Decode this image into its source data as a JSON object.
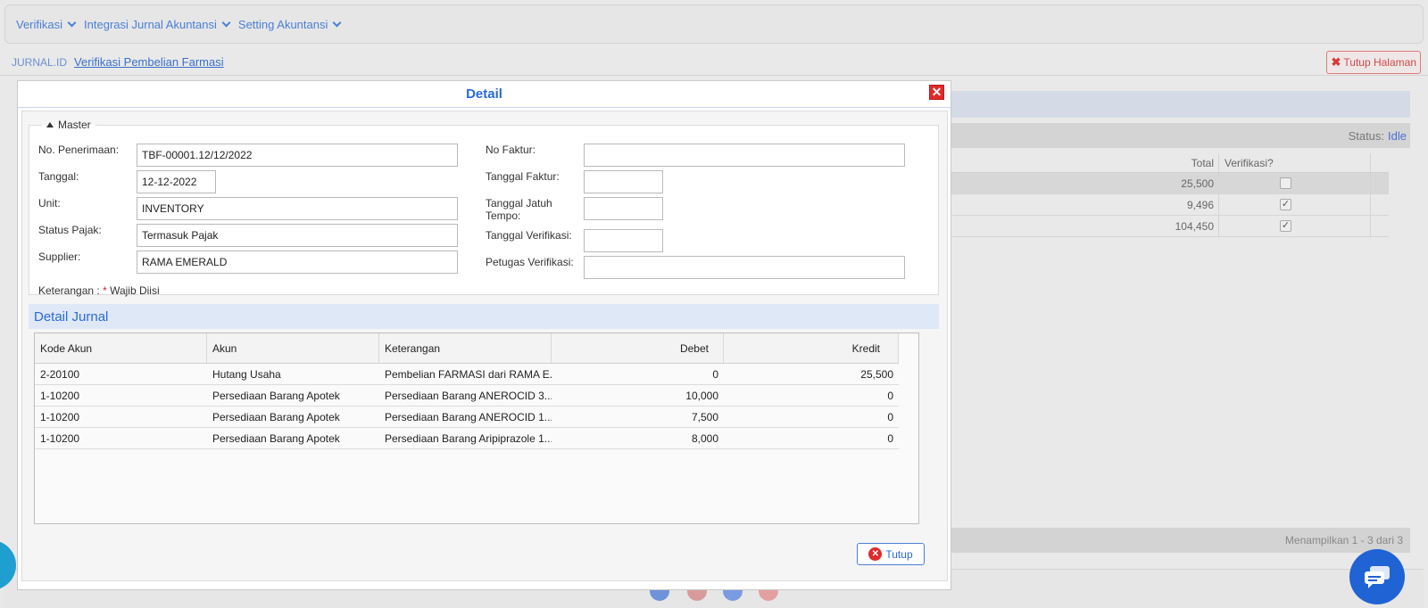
{
  "nav": {
    "menus": [
      "Verifikasi",
      "Integrasi Jurnal Akuntansi",
      "Setting Akuntansi"
    ]
  },
  "breadcrumb": {
    "root": "JURNAL.ID",
    "current": "Verifikasi Pembelian Farmasi"
  },
  "close_page_label": "Tutup Halaman",
  "background_grid": {
    "status_label": "Status:",
    "status_value": "Idle",
    "columns": [
      "Total",
      "Verifikasi?"
    ],
    "rows": [
      {
        "total": "25,500",
        "verified": false
      },
      {
        "total": "9,496",
        "verified": true
      },
      {
        "total": "104,450",
        "verified": true
      }
    ],
    "pagination": "Menampilkan 1 - 3 dari 3"
  },
  "modal": {
    "title": "Detail",
    "master_legend": "Master",
    "fields_left": [
      {
        "label": "No. Penerimaan:",
        "value": "TBF-00001.12/12/2022"
      },
      {
        "label": "Tanggal:",
        "value": "12-12-2022"
      },
      {
        "label": "Unit:",
        "value": "INVENTORY"
      },
      {
        "label": "Status Pajak:",
        "value": "Termasuk Pajak"
      },
      {
        "label": "Supplier:",
        "value": "RAMA EMERALD"
      }
    ],
    "fields_right": [
      {
        "label": "No Faktur:",
        "value": ""
      },
      {
        "label": "Tanggal Faktur:",
        "value": ""
      },
      {
        "label": "Tanggal Jatuh Tempo:",
        "value": ""
      },
      {
        "label": "Tanggal Verifikasi:",
        "value": ""
      },
      {
        "label": "Petugas Verifikasi:",
        "value": ""
      }
    ],
    "keterangan_label": "Keterangan :",
    "required_star": "*",
    "required_text": "Wajib Diisi",
    "detail_title": "Detail Jurnal",
    "grid_columns": [
      "Kode Akun",
      "Akun",
      "Keterangan",
      "Debet",
      "Kredit"
    ],
    "grid_rows": [
      [
        "2-20100",
        "Hutang Usaha",
        "Pembelian FARMASI dari RAMA E...",
        "0",
        "25,500"
      ],
      [
        "1-10200",
        "Persediaan Barang Apotek",
        "Persediaan Barang ANEROCID 3...",
        "10,000",
        "0"
      ],
      [
        "1-10200",
        "Persediaan Barang Apotek",
        "Persediaan Barang ANEROCID 1...",
        "7,500",
        "0"
      ],
      [
        "1-10200",
        "Persediaan Barang Apotek",
        "Persediaan Barang Aripiprazole 1...",
        "8,000",
        "0"
      ]
    ],
    "close_button": "Tutup"
  }
}
